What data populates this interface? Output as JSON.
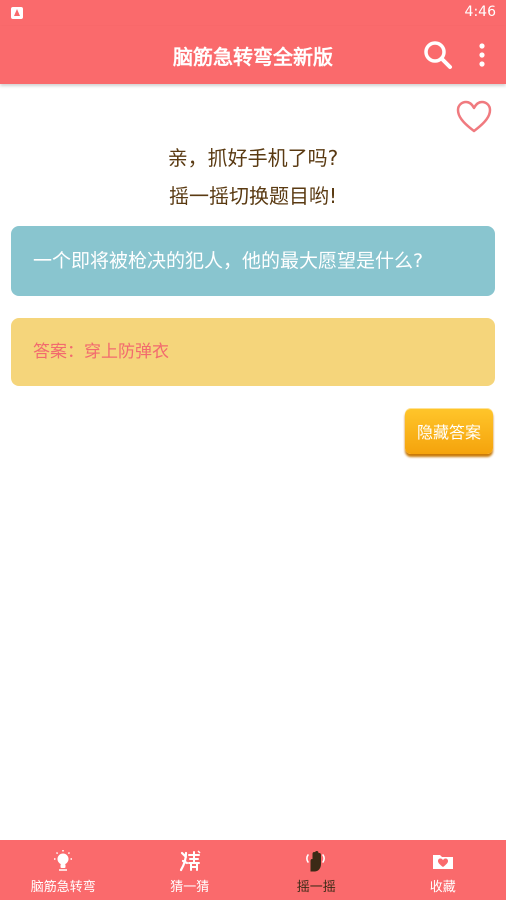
{
  "status_bar": {
    "time": "4:46"
  },
  "app_bar": {
    "title": "脑筋急转弯全新版",
    "search_icon": "search-icon",
    "more_icon": "more-vert-icon"
  },
  "favorite": {
    "icon": "heart-outline-icon",
    "color": "#f07a7f"
  },
  "prompt": {
    "line1": "亲，抓好手机了吗?",
    "line2": "摇一摇切换题目哟!"
  },
  "question": {
    "text": "一个即将被枪决的犯人，他的最大愿望是什么?",
    "color": "#89c5cf"
  },
  "answer": {
    "text": "答案：穿上防弹衣",
    "color": "#f5d57b"
  },
  "hide_answer_button": {
    "label": "隐藏答案"
  },
  "bottom_nav": {
    "active_index": 2,
    "items": [
      {
        "label": "脑筋急转弯",
        "icon": "lightbulb-icon"
      },
      {
        "label": "猜一猜",
        "icon": "guess-char-icon"
      },
      {
        "label": "摇一摇",
        "icon": "shake-hand-icon"
      },
      {
        "label": "收藏",
        "icon": "heart-folder-icon"
      }
    ]
  },
  "colors": {
    "primary": "#fa6a6c",
    "prompt_text": "#5a3a12",
    "button": "#f9b417"
  }
}
